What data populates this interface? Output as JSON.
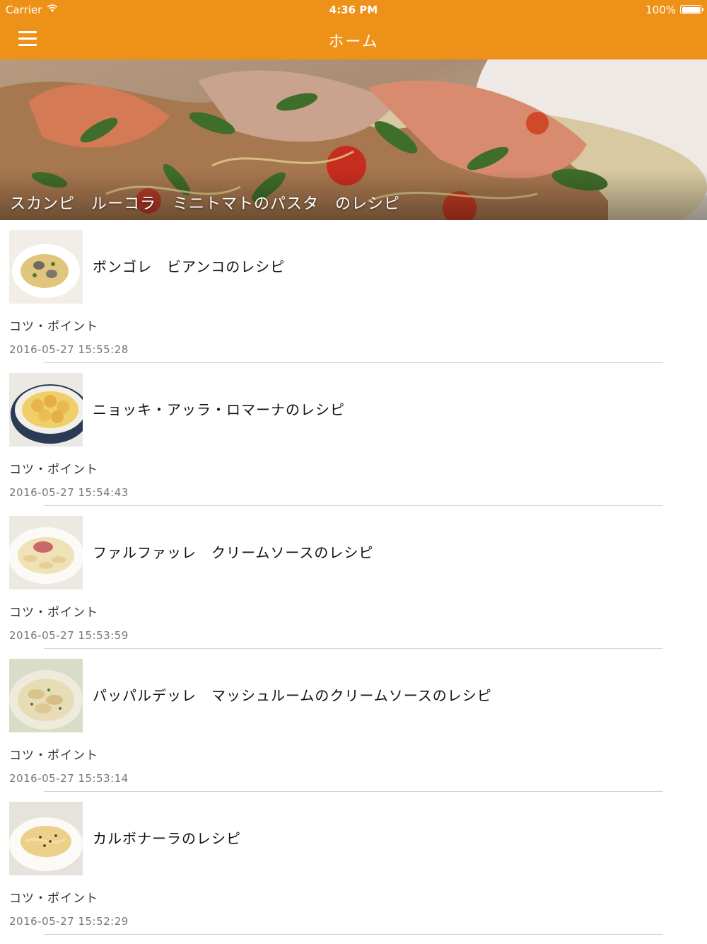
{
  "status_bar": {
    "carrier": "Carrier",
    "time": "4:36 PM",
    "battery": "100%"
  },
  "nav": {
    "title": "ホーム",
    "menu_icon": "hamburger-menu-icon"
  },
  "hero": {
    "caption": "スカンピ　ルーコラ　ミニトマトのパスタ　のレシピ"
  },
  "recipes": [
    {
      "title": "ボンゴレ　ビアンコのレシピ",
      "tip": "コツ・ポイント",
      "date": "2016-05-27 15:55:28"
    },
    {
      "title": "ニョッキ・アッラ・ロマーナのレシピ",
      "tip": "コツ・ポイント",
      "date": "2016-05-27 15:54:43"
    },
    {
      "title": "ファルファッレ　クリームソースのレシピ",
      "tip": "コツ・ポイント",
      "date": "2016-05-27 15:53:59"
    },
    {
      "title": "パッパルデッレ　マッシュルームのクリームソースのレシピ",
      "tip": "コツ・ポイント",
      "date": "2016-05-27 15:53:14"
    },
    {
      "title": "カルボナーラのレシピ",
      "tip": "コツ・ポイント",
      "date": "2016-05-27 15:52:29"
    }
  ],
  "colors": {
    "accent": "#ee9119",
    "separator": "#d4d4d4"
  }
}
